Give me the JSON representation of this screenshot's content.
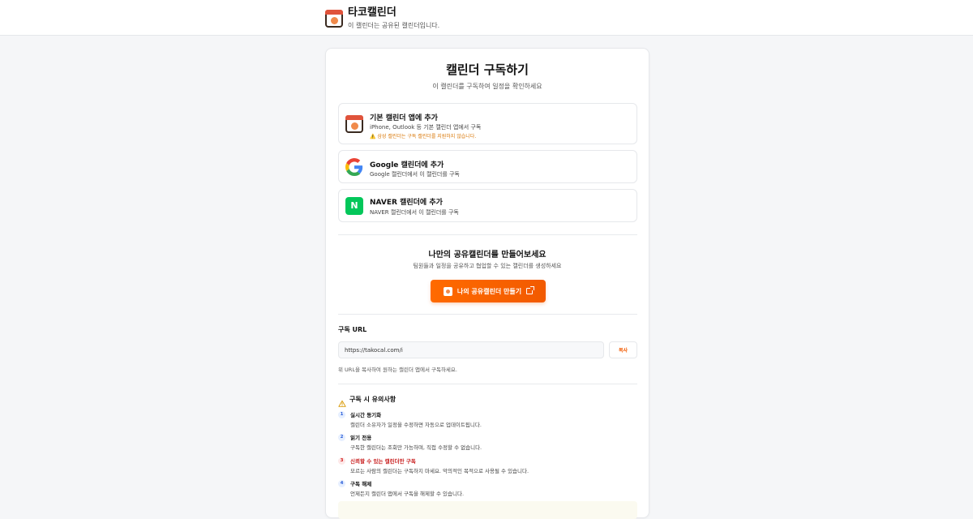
{
  "header": {
    "app_title": "타코캘린더",
    "subtitle": "이 캘린더는 공유된 캘린더입니다."
  },
  "card": {
    "title": "캘린더 구독하기",
    "subtitle": "이 캘린더를 구독하여 일정을 확인하세요",
    "options": [
      {
        "title": "기본 캘린더 앱에 추가",
        "desc": "iPhone, Outlook 등 기본 캘린더 앱에서 구독",
        "warning": "⚠️ 삼성 캘린더는 구독 캘린더를 지원하지 않습니다."
      },
      {
        "title": "Google 캘린더에 추가",
        "desc": "Google 캘린더에서 이 캘린더를 구독"
      },
      {
        "title": "NAVER 캘린더에 추가",
        "desc": "NAVER 캘린더에서 이 캘린더를 구독",
        "icon_letter": "N"
      }
    ],
    "cta": {
      "title": "나만의 공유캘린더를 만들어보세요",
      "subtitle": "팀원들과 일정을 공유하고 협업할 수 있는 캘린더를 생성하세요",
      "button_label": "나의 공유캘린더 만들기"
    },
    "url": {
      "label": "구독 URL",
      "value": "https://takocal.com/i",
      "copy_label": "복사",
      "help": "위 URL을 복사하여 원하는 캘린더 앱에서 구독하세요."
    },
    "notes": {
      "title": "구독 시 유의사항",
      "items": [
        {
          "num": "1",
          "title": "실시간 동기화",
          "desc": "캘린더 소유자가 일정을 수정하면 자동으로 업데이트됩니다."
        },
        {
          "num": "2",
          "title": "읽기 전용",
          "desc": "구독한 캘린더는 조회만 가능하며, 직접 수정할 수 없습니다."
        },
        {
          "num": "3",
          "title": "신뢰할 수 있는 캘린더만 구독",
          "desc": "모르는 사람의 캘린더는 구독하지 마세요. 악의적인 목적으로 사용될 수 있습니다."
        },
        {
          "num": "4",
          "title": "구독 해제",
          "desc": "언제든지 캘린더 앱에서 구독을 해제할 수 있습니다."
        }
      ]
    }
  },
  "colors": {
    "accent": "#f25a00",
    "naver": "#03c75a",
    "warning": "#d97706",
    "danger": "#c81e1e"
  },
  "icons": {
    "brand": "calendar-octopus-icon",
    "google": "google-g-icon",
    "naver": "naver-n-icon",
    "external": "external-link-icon",
    "warning": "warning-triangle-icon"
  }
}
